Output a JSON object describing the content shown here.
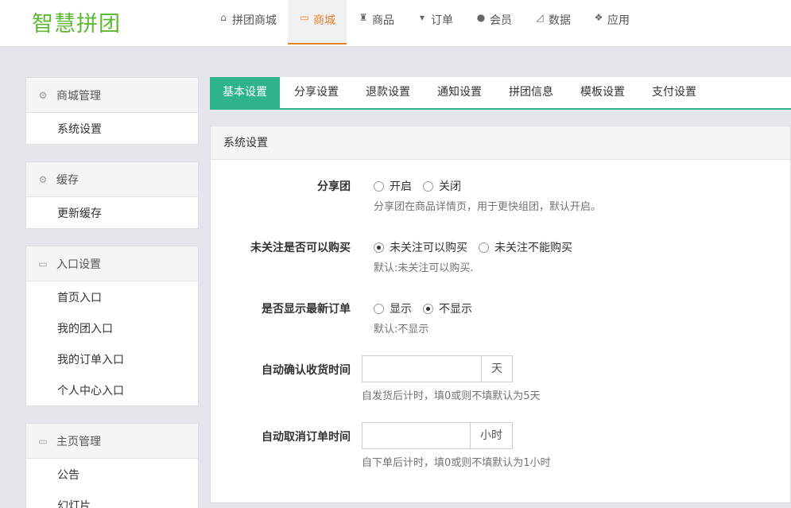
{
  "logo": "智慧拼团",
  "topnav": [
    {
      "label": "拼团商城",
      "icon": "home-icon",
      "glyph": "⌂"
    },
    {
      "label": "商城",
      "icon": "monitor-icon",
      "glyph": "▭"
    },
    {
      "label": "商品",
      "icon": "gift-icon",
      "glyph": "♜"
    },
    {
      "label": "订单",
      "icon": "cart-icon",
      "glyph": "▾"
    },
    {
      "label": "会员",
      "icon": "user-icon",
      "glyph": "●"
    },
    {
      "label": "数据",
      "icon": "chart-icon",
      "glyph": "◿"
    },
    {
      "label": "应用",
      "icon": "cubes-icon",
      "glyph": "❖"
    }
  ],
  "sidebar": [
    {
      "title": "商城管理",
      "icon": "gear-icon",
      "items": [
        "系统设置"
      ]
    },
    {
      "title": "缓存",
      "icon": "gear-icon",
      "items": [
        "更新缓存"
      ]
    },
    {
      "title": "入口设置",
      "icon": "inbox-icon",
      "items": [
        "首页入口",
        "我的团入口",
        "我的订单入口",
        "个人中心入口"
      ]
    },
    {
      "title": "主页管理",
      "icon": "inbox-icon",
      "items": [
        "公告",
        "幻灯片"
      ]
    }
  ],
  "tabs": [
    "基本设置",
    "分享设置",
    "退款设置",
    "通知设置",
    "拼团信息",
    "模板设置",
    "支付设置"
  ],
  "panel": {
    "title": "系统设置",
    "share": {
      "label": "分享团",
      "opt_on": "开启",
      "opt_off": "关闭",
      "help": "分享团在商品详情页，用于更快组团，默认开启。"
    },
    "follow": {
      "label": "未关注是否可以购买",
      "opt_yes": "未关注可以购买",
      "opt_no": "未关注不能购买",
      "help": "默认:未关注可以购买."
    },
    "latest": {
      "label": "是否显示最新订单",
      "opt_show": "显示",
      "opt_hide": "不显示",
      "help": "默认:不显示"
    },
    "confirm": {
      "label": "自动确认收货时间",
      "value": "",
      "unit": "天",
      "help": "自发货后计时，填0或则不填默认为5天"
    },
    "cancel": {
      "label": "自动取消订单时间",
      "value": "",
      "unit": "小时",
      "help": "自下单后计时，填0或则不填默认为1小时"
    }
  }
}
